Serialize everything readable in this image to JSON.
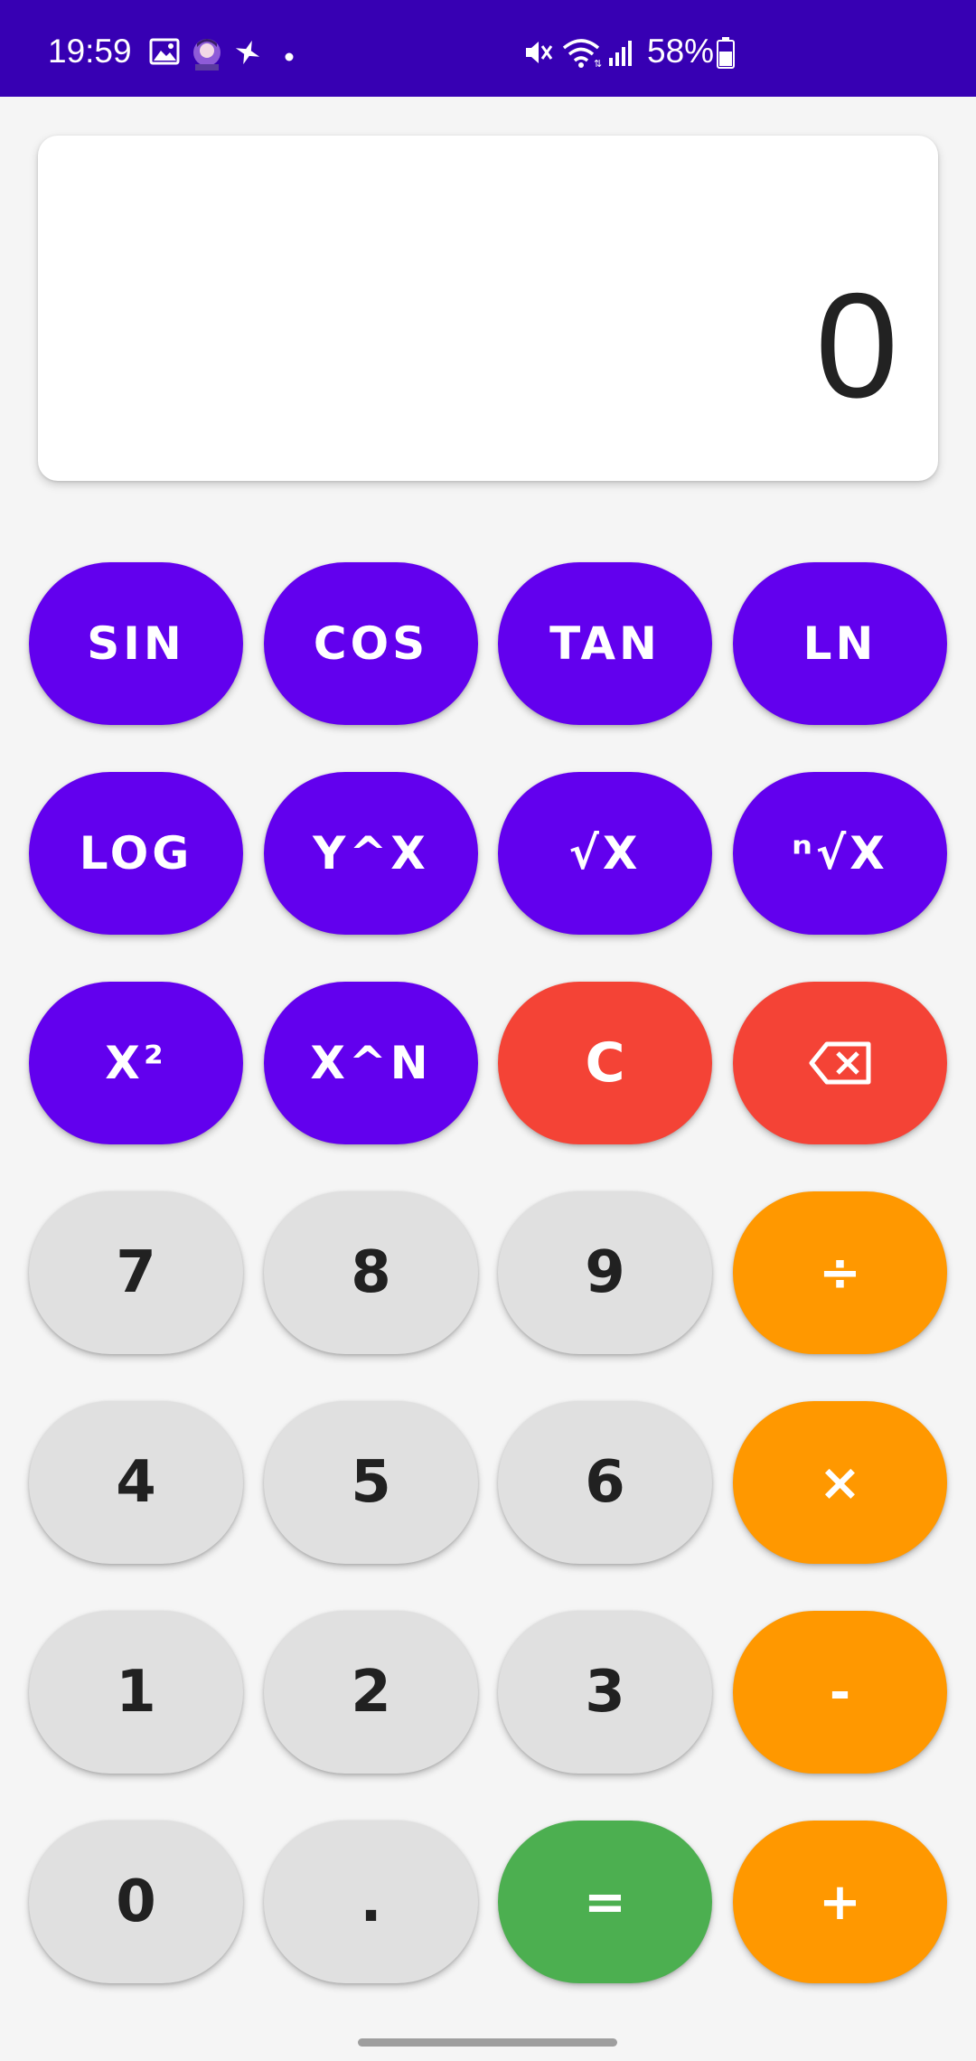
{
  "status_bar": {
    "time": "19:59",
    "battery": "58%",
    "icons": [
      "image-icon",
      "avatar-icon",
      "sparkle-icon",
      "dot-icon",
      "mute-icon",
      "wifi-icon",
      "signal-icon",
      "battery-icon"
    ]
  },
  "display": {
    "value": "0"
  },
  "keys": {
    "sin": "SIN",
    "cos": "COS",
    "tan": "TAN",
    "ln": "LN",
    "log": "LOG",
    "y_pow_x": "Y^X",
    "sqrt_x": "√X",
    "nth_root_x": "ⁿ√X",
    "x_squared": "X²",
    "x_pow_n": "X^N",
    "clear": "C",
    "backspace": "backspace-icon",
    "seven": "7",
    "eight": "8",
    "nine": "9",
    "divide": "÷",
    "four": "4",
    "five": "5",
    "six": "6",
    "multiply": "×",
    "one": "1",
    "two": "2",
    "three": "3",
    "minus": "-",
    "zero": "0",
    "decimal": ".",
    "equals": "=",
    "plus": "+"
  },
  "colors": {
    "status_bar": "#3700B3",
    "function_key": "#6200EE",
    "clear_key": "#F44336",
    "number_key": "#E0E0E0",
    "operator_key": "#FF9800",
    "equals_key": "#4CAF50"
  }
}
